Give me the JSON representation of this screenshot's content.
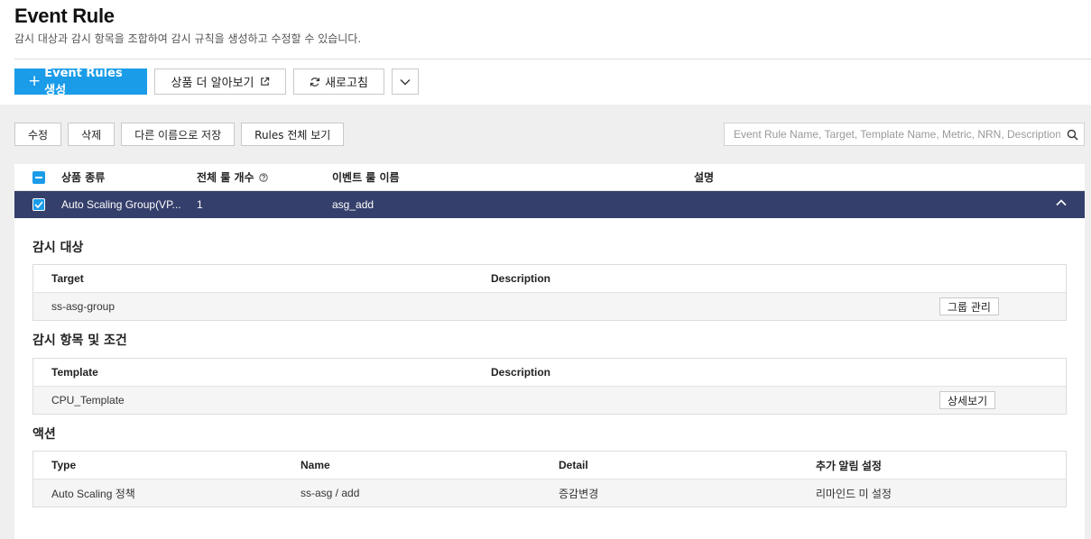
{
  "header": {
    "title": "Event Rule",
    "description": "감시 대상과 감시 항목을 조합하여 감시 규칙을 생성하고 수정할 수 있습니다."
  },
  "toolbar": {
    "create_label": "Event Rules 생성",
    "learn_more_label": "상품 더 알아보기",
    "refresh_label": "새로고침"
  },
  "actions": {
    "edit": "수정",
    "delete": "삭제",
    "save_as": "다른 이름으로 저장",
    "view_all": "Rules 전체 보기"
  },
  "search": {
    "placeholder": "Event Rule Name, Target, Template Name, Metric, NRN, Description"
  },
  "table": {
    "headers": {
      "product_type": "상품 종류",
      "rule_count": "전체 룰 개수",
      "rule_name": "이벤트 룰 이름",
      "description": "설명"
    },
    "selected_row": {
      "product_type": "Auto Scaling Group(VP...",
      "rule_count": "1",
      "rule_name": "asg_add",
      "description": ""
    }
  },
  "detail": {
    "targets": {
      "title": "감시 대상",
      "headers": {
        "col1": "Target",
        "col2": "Description"
      },
      "row": {
        "col1": "ss-asg-group",
        "col2": "",
        "button": "그룹 관리"
      }
    },
    "conditions": {
      "title": "감시 항목 및 조건",
      "headers": {
        "col1": "Template",
        "col2": "Description"
      },
      "row": {
        "col1": "CPU_Template",
        "col2": "",
        "button": "상세보기"
      }
    },
    "actions": {
      "title": "액션",
      "headers": {
        "type": "Type",
        "name": "Name",
        "detail": "Detail",
        "extra": "추가 알림 설정"
      },
      "row": {
        "type": "Auto Scaling 정책",
        "name": "ss-asg / add",
        "detail": "증감변경",
        "extra": "리마인드 미 설정"
      }
    }
  },
  "colors": {
    "primary": "#1a9ce8",
    "selected_row": "#353f6b",
    "background_gray": "#efefef"
  }
}
